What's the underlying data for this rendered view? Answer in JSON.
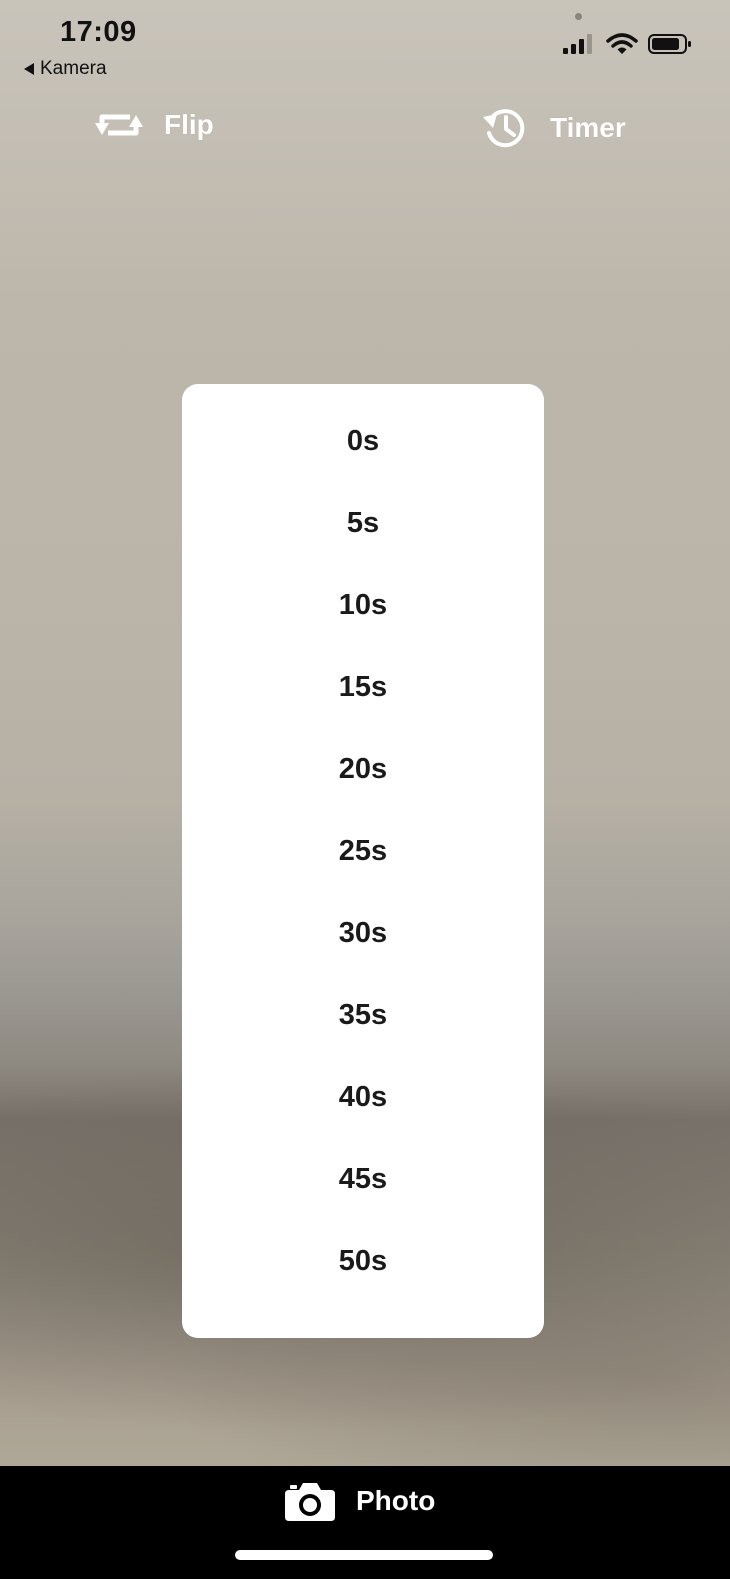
{
  "status_bar": {
    "time": "17:09",
    "back_label": "Kamera"
  },
  "controls": {
    "flip_label": "Flip",
    "timer_label": "Timer"
  },
  "timer_options": [
    "0s",
    "5s",
    "10s",
    "15s",
    "20s",
    "25s",
    "30s",
    "35s",
    "40s",
    "45s",
    "50s"
  ],
  "bottom_bar": {
    "photo_label": "Photo"
  },
  "icons": {
    "flip": "repeat-arrows-icon",
    "timer": "clock-history-icon",
    "photo": "camera-icon",
    "signal": "cellular-signal-icon",
    "wifi": "wifi-icon",
    "battery": "battery-icon"
  },
  "colors": {
    "panel_background": "#ffffff",
    "option_text": "#1a1a1a",
    "control_text": "#ffffff",
    "bottom_bar": "#000000"
  }
}
